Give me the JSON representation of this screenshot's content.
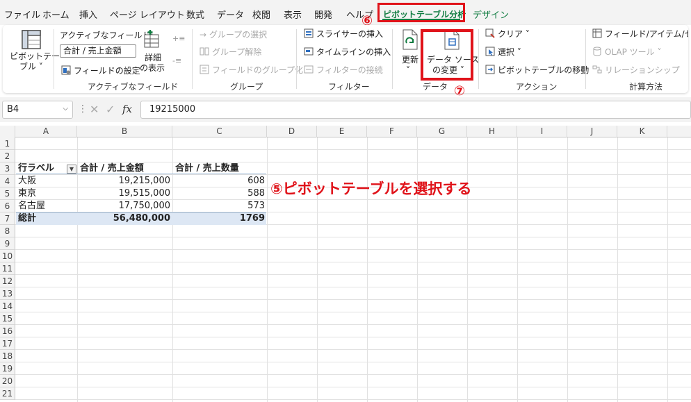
{
  "tabs": [
    {
      "id": "file",
      "label": "ファイル",
      "active": false
    },
    {
      "id": "home",
      "label": "ホーム",
      "active": false
    },
    {
      "id": "insert",
      "label": "挿入",
      "active": false
    },
    {
      "id": "page_layout",
      "label": "ページ レイアウト",
      "active": false
    },
    {
      "id": "formulas",
      "label": "数式",
      "active": false
    },
    {
      "id": "data",
      "label": "データ",
      "active": false
    },
    {
      "id": "review",
      "label": "校閲",
      "active": false
    },
    {
      "id": "view",
      "label": "表示",
      "active": false
    },
    {
      "id": "developer",
      "label": "開発",
      "active": false
    },
    {
      "id": "help",
      "label": "ヘルプ",
      "active": false
    },
    {
      "id": "pivot_analyze",
      "label": "ピボットテーブル分析",
      "active": true
    },
    {
      "id": "design",
      "label": "デザイン",
      "active": false
    }
  ],
  "step_numbers": {
    "tab": "⑥",
    "button": "⑦"
  },
  "ribbon": {
    "pivottable": {
      "label_line1": "ピボットテー",
      "label_line2": "ブル ˅"
    },
    "active_field": {
      "caption": "アクティブなフィールド:",
      "value": "合計 / 売上金額",
      "settings": "フィールドの設定",
      "drill_line1": "詳細",
      "drill_line2": "の表示",
      "group_label": "アクティブなフィールド"
    },
    "group": {
      "selection": "→ グループの選択",
      "ungroup": "グループ解除",
      "group_field": "フィールドのグループ化",
      "group_label": "グループ"
    },
    "filter": {
      "slicer": "スライサーの挿入",
      "timeline": "タイムラインの挿入",
      "connections": "フィルターの接続",
      "group_label": "フィルター"
    },
    "data": {
      "refresh_line1": "更新",
      "refresh_line2": "˅",
      "change_source_line1": "データ ソース",
      "change_source_line2": "の変更 ˅",
      "group_label": "データ"
    },
    "actions": {
      "clear": "クリア ˅",
      "select": "選択 ˅",
      "move": "ピボットテーブルの移動",
      "group_label": "アクション"
    },
    "calculations": {
      "fields_items": "フィールド/アイテム/セット ˅",
      "olap": "OLAP ツール ˅",
      "relationships": "リレーションシップ",
      "group_label": "計算方法"
    }
  },
  "formula_bar": {
    "name_box": "B4",
    "fx": "fx",
    "value": "19215000"
  },
  "grid": {
    "columns": [
      "A",
      "B",
      "C",
      "D",
      "E",
      "F",
      "G",
      "H",
      "I",
      "J",
      "K"
    ],
    "rows": [
      "1",
      "2",
      "3",
      "4",
      "5",
      "6",
      "7",
      "8",
      "9",
      "10",
      "11",
      "12",
      "13",
      "14",
      "15",
      "16",
      "17",
      "18",
      "19",
      "20",
      "21"
    ]
  },
  "pivot": {
    "headers": [
      "行ラベル",
      "合計 / 売上金額",
      "合計 / 売上数量"
    ],
    "rows": [
      {
        "label": "大阪",
        "amount": "19,215,000",
        "qty": "608"
      },
      {
        "label": "東京",
        "amount": "19,515,000",
        "qty": "588"
      },
      {
        "label": "名古屋",
        "amount": "17,750,000",
        "qty": "573"
      }
    ],
    "total": {
      "label": "総計",
      "amount": "56,480,000",
      "qty": "1769"
    }
  },
  "annotation": "⑤ピボットテーブルを選択する",
  "colors": {
    "accent_green": "#107c41",
    "annotation_red": "#e0131a",
    "pivot_band": "#dde7f4"
  }
}
